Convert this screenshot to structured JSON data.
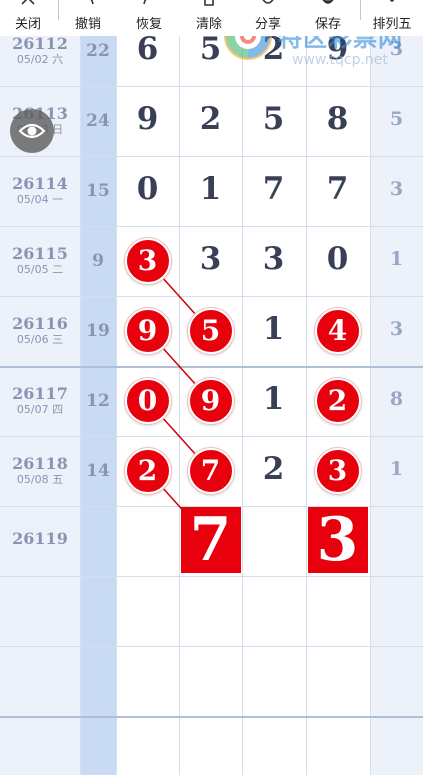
{
  "toolbar": {
    "items": [
      {
        "label": "关闭",
        "icon": "close-icon"
      },
      {
        "label": "撤销",
        "icon": "undo-icon"
      },
      {
        "label": "恢复",
        "icon": "redo-icon"
      },
      {
        "label": "清除",
        "icon": "trash-icon"
      },
      {
        "label": "分享",
        "icon": "share-icon"
      },
      {
        "label": "保存",
        "icon": "download-icon"
      },
      {
        "label": "排列五",
        "icon": "chevron-down-icon"
      }
    ]
  },
  "watermark": {
    "title": "特区彩票网",
    "url": "www.tqcp.net"
  },
  "rows": [
    {
      "issue": "26112",
      "date": "05/02 六",
      "sum": "22",
      "digits": [
        "6",
        "5",
        "2",
        "9"
      ],
      "span": "3"
    },
    {
      "issue": "26113",
      "date": "05/03 日",
      "sum": "24",
      "digits": [
        "9",
        "2",
        "5",
        "8"
      ],
      "span": "5"
    },
    {
      "issue": "26114",
      "date": "05/04 一",
      "sum": "15",
      "digits": [
        "0",
        "1",
        "7",
        "7"
      ],
      "span": "3"
    },
    {
      "issue": "26115",
      "date": "05/05 二",
      "sum": "9",
      "digits": [
        "3",
        "3",
        "3",
        "0"
      ],
      "span": "1"
    },
    {
      "issue": "26116",
      "date": "05/06 三",
      "sum": "19",
      "digits": [
        "9",
        "5",
        "1",
        "4"
      ],
      "span": "3"
    },
    {
      "issue": "26117",
      "date": "05/07 四",
      "sum": "12",
      "digits": [
        "0",
        "9",
        "1",
        "2"
      ],
      "span": "8"
    },
    {
      "issue": "26118",
      "date": "05/08 五",
      "sum": "14",
      "digits": [
        "2",
        "7",
        "2",
        "3"
      ],
      "span": "1"
    },
    {
      "issue": "26119",
      "date": "",
      "sum": "",
      "digits": [
        "",
        "",
        "",
        ""
      ],
      "span": ""
    }
  ],
  "marks": {
    "balls": [
      {
        "row": 3,
        "col": 0
      },
      {
        "row": 4,
        "col": 0
      },
      {
        "row": 4,
        "col": 1
      },
      {
        "row": 4,
        "col": 3
      },
      {
        "row": 5,
        "col": 0
      },
      {
        "row": 5,
        "col": 1
      },
      {
        "row": 5,
        "col": 3
      },
      {
        "row": 6,
        "col": 0
      },
      {
        "row": 6,
        "col": 1
      },
      {
        "row": 6,
        "col": 3
      }
    ],
    "links": [
      {
        "from": {
          "row": 3,
          "col": 0
        },
        "to": {
          "row": 4,
          "col": 1
        }
      },
      {
        "from": {
          "row": 4,
          "col": 0
        },
        "to": {
          "row": 5,
          "col": 1
        }
      },
      {
        "from": {
          "row": 5,
          "col": 0
        },
        "to": {
          "row": 6,
          "col": 1
        }
      },
      {
        "from": {
          "row": 6,
          "col": 0
        },
        "to": {
          "row": 7,
          "col": 1
        }
      }
    ],
    "predictions": [
      {
        "row": 7,
        "col": 1,
        "value": "7"
      },
      {
        "row": 7,
        "col": 3,
        "value": "3"
      }
    ]
  },
  "colors": {
    "ball": "#e8000d",
    "link": "#d0000b",
    "issue_text": "#8a93b2",
    "digit_text": "#3a3f58",
    "sum_column": "#c9dbf4"
  }
}
